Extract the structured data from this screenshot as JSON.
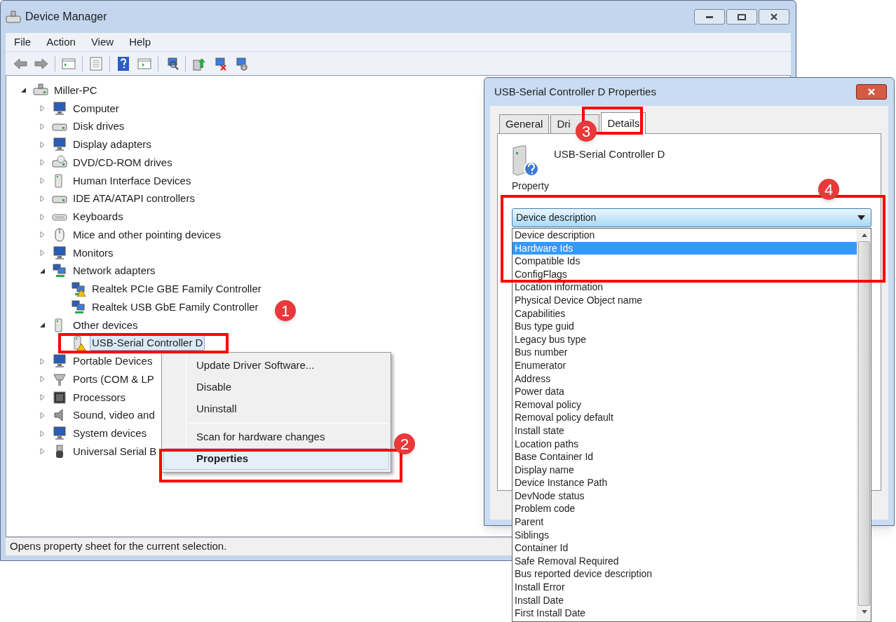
{
  "window": {
    "title": "Device Manager",
    "menu": [
      "File",
      "Action",
      "View",
      "Help"
    ],
    "status_bar": "Opens property sheet for the current selection."
  },
  "tree": {
    "label": "Miller-PC",
    "kind": "pc",
    "expanded": true,
    "selected": false,
    "children": [
      {
        "label": "Computer",
        "kind": "computer",
        "expanded": false,
        "selected": false
      },
      {
        "label": "Disk drives",
        "kind": "disk",
        "expanded": false,
        "selected": false
      },
      {
        "label": "Display adapters",
        "kind": "display",
        "expanded": false,
        "selected": false
      },
      {
        "label": "DVD/CD-ROM drives",
        "kind": "dvd",
        "expanded": false,
        "selected": false
      },
      {
        "label": "Human Interface Devices",
        "kind": "hid",
        "expanded": false,
        "selected": false
      },
      {
        "label": "IDE ATA/ATAPI controllers",
        "kind": "ide",
        "expanded": false,
        "selected": false
      },
      {
        "label": "Keyboards",
        "kind": "keyboard",
        "expanded": false,
        "selected": false
      },
      {
        "label": "Mice and other pointing devices",
        "kind": "mouse",
        "expanded": false,
        "selected": false
      },
      {
        "label": "Monitors",
        "kind": "monitor",
        "expanded": false,
        "selected": false
      },
      {
        "label": "Network adapters",
        "kind": "network",
        "expanded": true,
        "selected": false,
        "children": [
          {
            "label": "Realtek PCIe GBE Family Controller",
            "kind": "network-warning",
            "selected": false
          },
          {
            "label": "Realtek USB GbE Family Controller",
            "kind": "network",
            "selected": false
          }
        ]
      },
      {
        "label": "Other devices",
        "kind": "other",
        "expanded": true,
        "selected": false,
        "children": [
          {
            "label": "USB-Serial Controller D",
            "kind": "other-warning",
            "selected": true
          }
        ]
      },
      {
        "label": "Portable Devices",
        "kind": "portable",
        "expanded": false,
        "selected": false
      },
      {
        "label": "Ports (COM & LP",
        "kind": "port",
        "expanded": false,
        "selected": false
      },
      {
        "label": "Processors",
        "kind": "processor",
        "expanded": false,
        "selected": false
      },
      {
        "label": "Sound, video and",
        "kind": "sound",
        "expanded": false,
        "selected": false
      },
      {
        "label": "System devices",
        "kind": "system",
        "expanded": false,
        "selected": false
      },
      {
        "label": "Universal Serial B",
        "kind": "usb",
        "expanded": false,
        "selected": false
      }
    ]
  },
  "context_menu": [
    {
      "kind": "item",
      "label": "Update Driver Software...",
      "selected": false,
      "default": false
    },
    {
      "kind": "item",
      "label": "Disable",
      "selected": false,
      "default": false
    },
    {
      "kind": "item",
      "label": "Uninstall",
      "selected": false,
      "default": false
    },
    {
      "kind": "separator"
    },
    {
      "kind": "item",
      "label": "Scan for hardware changes",
      "selected": false,
      "default": false
    },
    {
      "kind": "item",
      "label": "Properties",
      "selected": true,
      "default": true
    }
  ],
  "dialog": {
    "title": "USB-Serial Controller D Properties",
    "tabs": [
      {
        "label": "General",
        "selected": false
      },
      {
        "label": "Dri",
        "selected": false
      },
      {
        "label": "Details",
        "selected": true
      }
    ],
    "device_name": "USB-Serial Controller D",
    "property_label": "Property",
    "property_value": "Device description",
    "options": [
      {
        "label": "Device description",
        "selected": false
      },
      {
        "label": "Hardware Ids",
        "selected": true
      },
      {
        "label": "Compatible Ids",
        "selected": false
      },
      {
        "label": "ConfigFlags",
        "selected": false
      },
      {
        "label": "Location information",
        "selected": false
      },
      {
        "label": "Physical Device Object name",
        "selected": false
      },
      {
        "label": "Capabilities",
        "selected": false
      },
      {
        "label": "Bus type guid",
        "selected": false
      },
      {
        "label": "Legacy bus type",
        "selected": false
      },
      {
        "label": "Bus number",
        "selected": false
      },
      {
        "label": "Enumerator",
        "selected": false
      },
      {
        "label": "Address",
        "selected": false
      },
      {
        "label": "Power data",
        "selected": false
      },
      {
        "label": "Removal policy",
        "selected": false
      },
      {
        "label": "Removal policy default",
        "selected": false
      },
      {
        "label": "Install state",
        "selected": false
      },
      {
        "label": "Location paths",
        "selected": false
      },
      {
        "label": "Base Container Id",
        "selected": false
      },
      {
        "label": "Display name",
        "selected": false
      },
      {
        "label": "Device Instance Path",
        "selected": false
      },
      {
        "label": "DevNode status",
        "selected": false
      },
      {
        "label": "Problem code",
        "selected": false
      },
      {
        "label": "Parent",
        "selected": false
      },
      {
        "label": "Siblings",
        "selected": false
      },
      {
        "label": "Container Id",
        "selected": false
      },
      {
        "label": "Safe Removal Required",
        "selected": false
      },
      {
        "label": "Bus reported device description",
        "selected": false
      },
      {
        "label": "Install Error",
        "selected": false
      },
      {
        "label": "Install Date",
        "selected": false
      },
      {
        "label": "First Install Date",
        "selected": false
      }
    ]
  },
  "annotations": [
    {
      "number": "1"
    },
    {
      "number": "2"
    },
    {
      "number": "3"
    },
    {
      "number": "4"
    }
  ]
}
